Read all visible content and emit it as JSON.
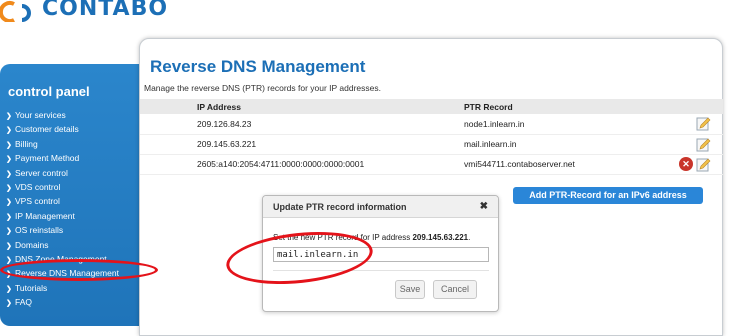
{
  "brand": {
    "name": "CONTABO",
    "logo_icon": "contabo-logo-icon",
    "color": "#1c6fb6"
  },
  "sidebar": {
    "title": "control panel",
    "items": [
      {
        "label": "Your services"
      },
      {
        "label": "Customer details"
      },
      {
        "label": "Billing"
      },
      {
        "label": "Payment Method"
      },
      {
        "label": "Server control"
      },
      {
        "label": "VDS control"
      },
      {
        "label": "VPS control"
      },
      {
        "label": "IP Management"
      },
      {
        "label": "OS reinstalls"
      },
      {
        "label": "Domains"
      },
      {
        "label": "DNS Zone Management"
      },
      {
        "label": "Reverse DNS Management"
      },
      {
        "label": "Tutorials"
      },
      {
        "label": "FAQ"
      }
    ],
    "active_item": "Reverse DNS Management"
  },
  "main": {
    "title": "Reverse DNS Management",
    "subtitle": "Manage the reverse DNS (PTR) records for your IP addresses.",
    "table": {
      "columns": [
        "IP Address",
        "PTR Record"
      ],
      "rows": [
        {
          "ip": "209.126.84.23",
          "ptr": "node1.inlearn.in"
        },
        {
          "ip": "209.145.63.221",
          "ptr": "mail.inlearn.in"
        },
        {
          "ip": "2605:a140:2054:4711:0000:0000:0000:0001",
          "ptr": "vmi544711.contaboserver.net"
        }
      ]
    },
    "add_button": "Add PTR-Record for an IPv6 address"
  },
  "dialog": {
    "title": "Update PTR record information",
    "prompt": "Set the new PTR record for IP address ",
    "ip": "209.145.63.221",
    "prompt_end": ".",
    "input_value": "mail.inlearn.in",
    "save": "Save",
    "cancel": "Cancel"
  },
  "colors": {
    "accent": "#1c6fb6",
    "sidebar": "#2b86cc",
    "annotation": "#e4131a",
    "button": "#2a86d8"
  }
}
